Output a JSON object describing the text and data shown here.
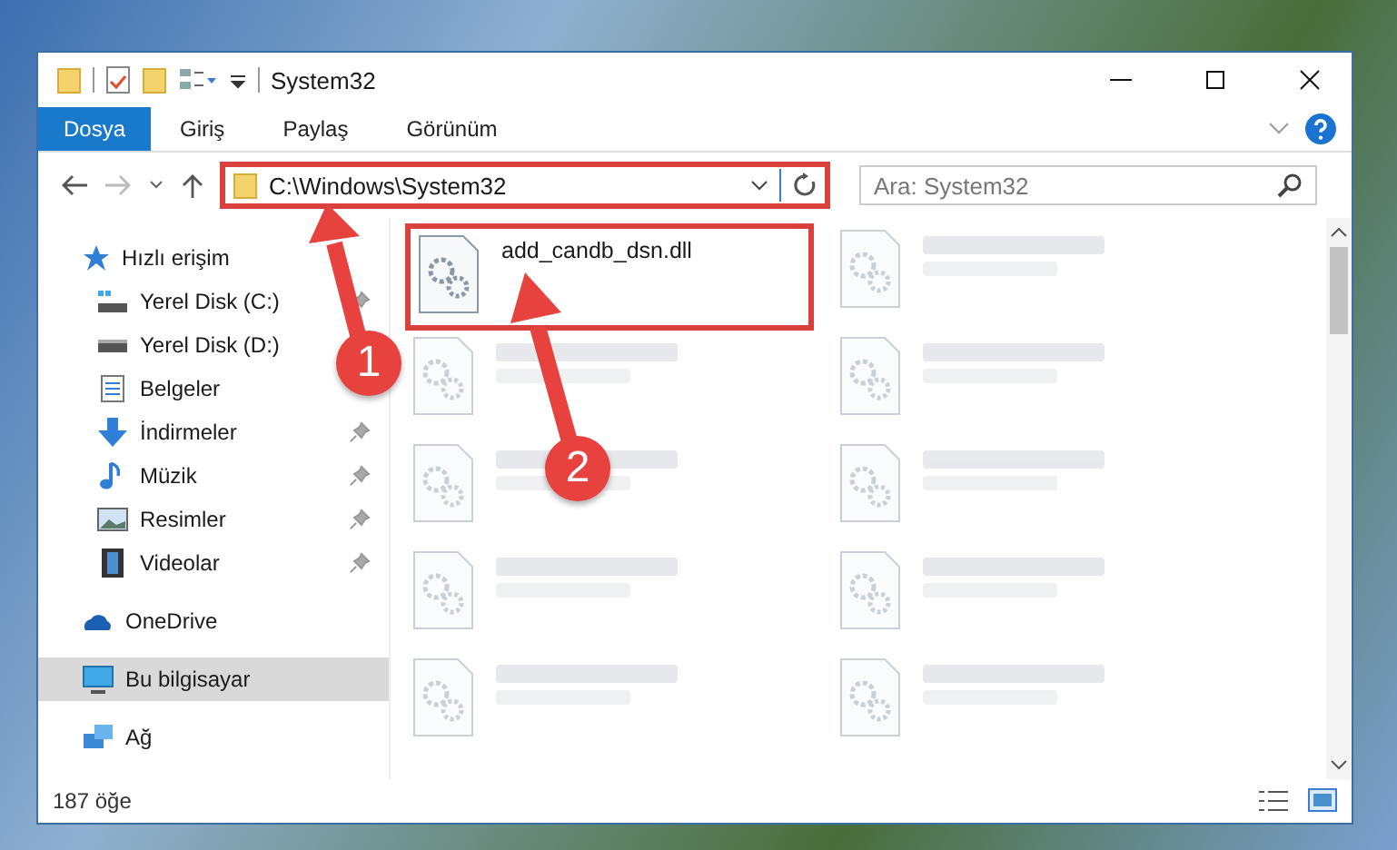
{
  "window": {
    "title": "System32"
  },
  "ribbon": {
    "tabs": [
      {
        "label": "Dosya",
        "selected": true
      },
      {
        "label": "Giriş",
        "selected": false
      },
      {
        "label": "Paylaş",
        "selected": false
      },
      {
        "label": "Görünüm",
        "selected": false
      }
    ]
  },
  "address": {
    "path": "C:\\Windows\\System32",
    "highlighted": true
  },
  "search": {
    "placeholder": "Ara: System32"
  },
  "sidebar": {
    "items": [
      {
        "label": "Hızlı erişim",
        "kind": "star",
        "selected": false,
        "children": [
          {
            "label": "Yerel Disk (C:)",
            "kind": "drive-c",
            "pinned": true
          },
          {
            "label": "Yerel Disk (D:)",
            "kind": "drive",
            "pinned": false
          },
          {
            "label": "Belgeler",
            "kind": "docs",
            "pinned": false
          },
          {
            "label": "İndirmeler",
            "kind": "download",
            "pinned": true
          },
          {
            "label": "Müzik",
            "kind": "music",
            "pinned": true
          },
          {
            "label": "Resimler",
            "kind": "pictures",
            "pinned": true
          },
          {
            "label": "Videolar",
            "kind": "videos",
            "pinned": true
          }
        ]
      },
      {
        "label": "OneDrive",
        "kind": "cloud",
        "selected": false
      },
      {
        "label": "Bu bilgisayar",
        "kind": "pc",
        "selected": true
      },
      {
        "label": "Ağ",
        "kind": "network",
        "selected": false
      }
    ]
  },
  "files": [
    {
      "name": "add_candb_dsn.dll",
      "blurred": false,
      "highlighted": true
    },
    {
      "blurred": true,
      "highlighted": false
    },
    {
      "blurred": true,
      "highlighted": false
    },
    {
      "blurred": true,
      "highlighted": false
    },
    {
      "blurred": true,
      "highlighted": false
    },
    {
      "blurred": true,
      "highlighted": false
    },
    {
      "blurred": true,
      "highlighted": false
    },
    {
      "blurred": true,
      "highlighted": false
    },
    {
      "blurred": true,
      "highlighted": false
    },
    {
      "blurred": true,
      "highlighted": false
    }
  ],
  "annotations": [
    {
      "label": "1"
    },
    {
      "label": "2"
    }
  ],
  "status_bar": {
    "count": "187 öğe"
  }
}
